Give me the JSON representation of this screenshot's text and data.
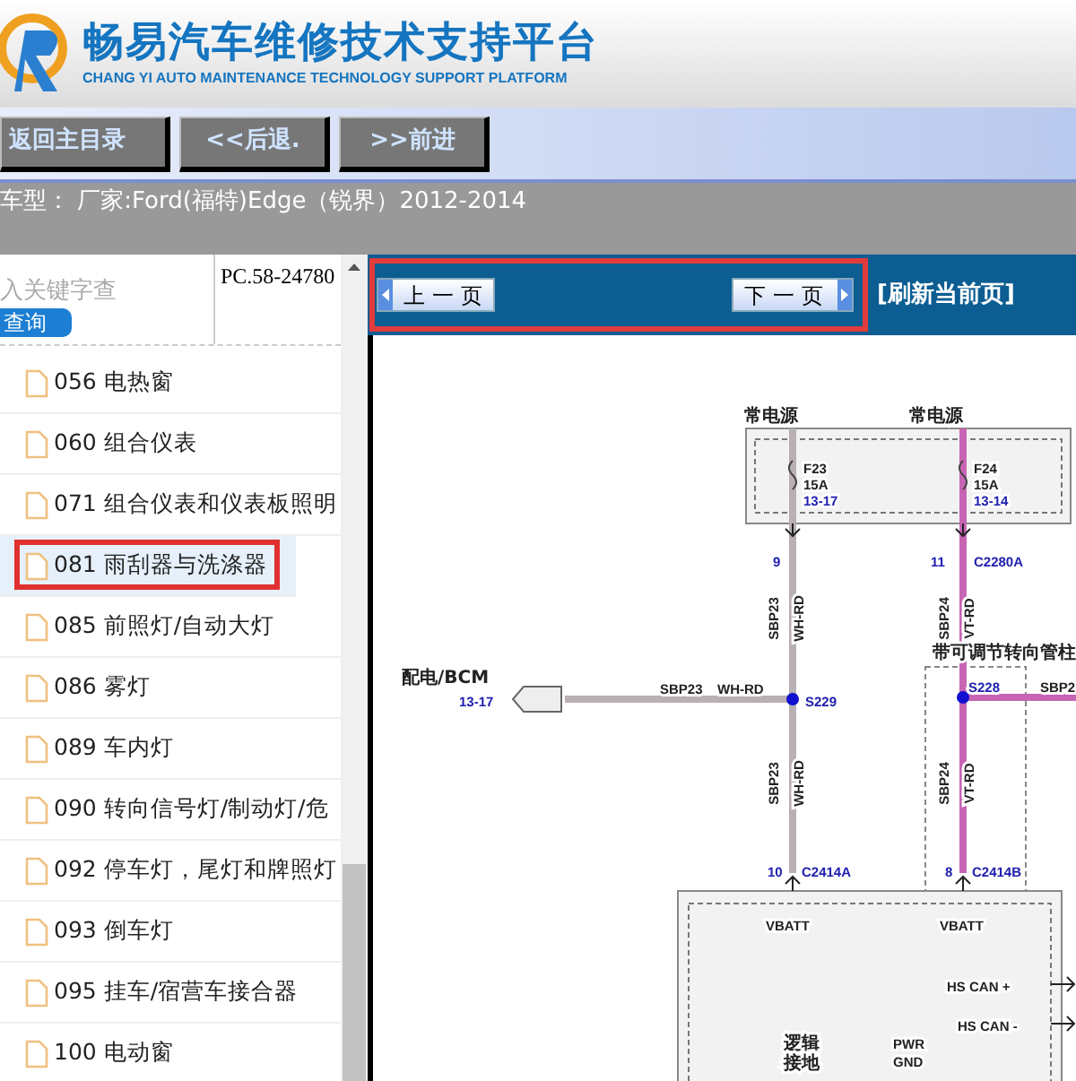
{
  "header": {
    "title": "畅易汽车维修技术支持平台",
    "subtitle": "CHANG YI AUTO MAINTENANCE TECHNOLOGY SUPPORT PLATFORM"
  },
  "nav_buttons": [
    "返回主目录",
    "<<后退.",
    ">>前进"
  ],
  "vehicle_info": "车型： 厂家:Ford(福特)Edge（锐界）2012-2014",
  "search": {
    "placeholder": "入关键字查",
    "button": "查询"
  },
  "document_code": "PC.58-24780",
  "sections": [
    {
      "label": "056 电热窗",
      "selected": false
    },
    {
      "label": "060 组合仪表",
      "selected": false
    },
    {
      "label": "071 组合仪表和仪表板照明",
      "selected": false
    },
    {
      "label": "081 雨刮器与洗涤器",
      "selected": true
    },
    {
      "label": "085 前照灯/自动大灯",
      "selected": false
    },
    {
      "label": "086 雾灯",
      "selected": false
    },
    {
      "label": "089 车内灯",
      "selected": false
    },
    {
      "label": "090 转向信号灯/制动灯/危",
      "selected": false
    },
    {
      "label": "092 停车灯，尾灯和牌照灯",
      "selected": false
    },
    {
      "label": "093 倒车灯",
      "selected": false
    },
    {
      "label": "095 挂车/宿营车接合器",
      "selected": false
    },
    {
      "label": "100 电动窗",
      "selected": false
    }
  ],
  "viewer": {
    "prev": "上一页",
    "next": "下一页",
    "refresh": "[刷新当前页]"
  },
  "diagram": {
    "labels": [
      {
        "text": "常电源",
        "kind": "label"
      },
      {
        "text": "常电源",
        "kind": "label"
      },
      {
        "text": "F23",
        "kind": "label"
      },
      {
        "text": "15A",
        "kind": "label"
      },
      {
        "text": "13-17",
        "kind": "ref"
      },
      {
        "text": "F24",
        "kind": "label"
      },
      {
        "text": "15A",
        "kind": "label"
      },
      {
        "text": "13-14",
        "kind": "ref"
      },
      {
        "text": "9",
        "kind": "ref"
      },
      {
        "text": "11",
        "kind": "ref"
      },
      {
        "text": "C2280A",
        "kind": "ref"
      },
      {
        "text": "SBP23",
        "kind": "vertical"
      },
      {
        "text": "WH-RD",
        "kind": "vertical"
      },
      {
        "text": "SBP24",
        "kind": "vertical"
      },
      {
        "text": "VT-RD",
        "kind": "vertical"
      },
      {
        "text": "带可调节转向管柱",
        "kind": "label"
      },
      {
        "text": "配电/BCM",
        "kind": "label"
      },
      {
        "text": "13-17",
        "kind": "ref"
      },
      {
        "text": "SBP23",
        "kind": "label"
      },
      {
        "text": "WH-RD",
        "kind": "label"
      },
      {
        "text": "S229",
        "kind": "ref"
      },
      {
        "text": "S228",
        "kind": "ref"
      },
      {
        "text": "SBP2",
        "kind": "label"
      },
      {
        "text": "SBP23",
        "kind": "vertical"
      },
      {
        "text": "WH-RD",
        "kind": "vertical"
      },
      {
        "text": "SBP24",
        "kind": "vertical"
      },
      {
        "text": "VT-RD",
        "kind": "vertical"
      },
      {
        "text": "10",
        "kind": "ref"
      },
      {
        "text": "C2414A",
        "kind": "ref"
      },
      {
        "text": "8",
        "kind": "ref"
      },
      {
        "text": "C2414B",
        "kind": "ref"
      },
      {
        "text": "VBATT",
        "kind": "label"
      },
      {
        "text": "VBATT",
        "kind": "label"
      },
      {
        "text": "HS CAN +",
        "kind": "label"
      },
      {
        "text": "HS CAN -",
        "kind": "label"
      },
      {
        "text": "逻辑",
        "kind": "label"
      },
      {
        "text": "接地",
        "kind": "label"
      },
      {
        "text": "PWR",
        "kind": "label"
      },
      {
        "text": "GND",
        "kind": "label"
      }
    ]
  }
}
